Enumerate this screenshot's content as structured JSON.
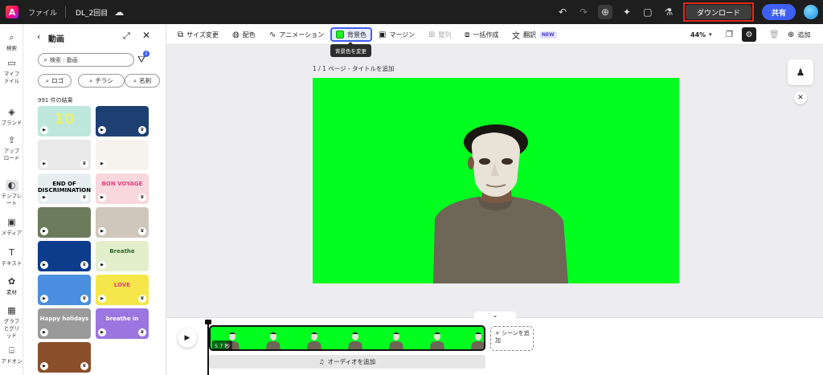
{
  "topbar": {
    "logo": "A",
    "file_menu": "ファイル",
    "doc_title": "DL_2回目",
    "download_label": "ダウンロード",
    "share_label": "共有",
    "icons": [
      "undo-icon",
      "redo-icon",
      "add-person-icon",
      "lightbulb-icon",
      "comment-icon",
      "flask-icon"
    ]
  },
  "rail": {
    "items": [
      {
        "label": "検索",
        "icon": "⌕"
      },
      {
        "label": "マイファイル",
        "icon": "▭"
      },
      {
        "label": "ブランド",
        "icon": "◈"
      },
      {
        "label": "アップロード",
        "icon": "⇪"
      },
      {
        "label": "テンプレート",
        "icon": "◐"
      },
      {
        "label": "メディア",
        "icon": "▣"
      },
      {
        "label": "テキスト",
        "icon": "T"
      },
      {
        "label": "素材",
        "icon": "✿"
      },
      {
        "label": "グラフとグリッド",
        "icon": "▦"
      },
      {
        "label": "アドオン",
        "icon": "⌸"
      }
    ]
  },
  "panel": {
    "title": "動画",
    "search_placeholder": "検索 : 動画",
    "filter_count": "2",
    "chips": [
      "ロゴ",
      "チラシ",
      "名刺"
    ],
    "result_count": "991 件の結果",
    "thumbs": [
      {
        "text": "10",
        "bg": "#bfe8dc",
        "fg": "#e5f073"
      },
      {
        "text": "",
        "bg": "#1e3f72",
        "fg": "#fff"
      },
      {
        "text": "",
        "bg": "#e9e9e9",
        "fg": "#000"
      },
      {
        "text": "",
        "bg": "#f7f4ee",
        "fg": "#000"
      },
      {
        "text": "END OF DISCRIMINATION",
        "bg": "#e6eef0",
        "fg": "#000"
      },
      {
        "text": "BON VOYAGE",
        "bg": "#f8d7dd",
        "fg": "#e0447b"
      },
      {
        "text": "",
        "bg": "#6d7b5d",
        "fg": "#fff"
      },
      {
        "text": "",
        "bg": "#cfc7bb",
        "fg": "#000"
      },
      {
        "text": "",
        "bg": "#0e3c8c",
        "fg": "#fff"
      },
      {
        "text": "Breathe",
        "bg": "#e3efcc",
        "fg": "#2b6a2b"
      },
      {
        "text": "",
        "bg": "#4a8fe0",
        "fg": "#fff"
      },
      {
        "text": "LOVE",
        "bg": "#f5e64a",
        "fg": "#e23a7a"
      },
      {
        "text": "Happy holidays",
        "bg": "#9a9a9a",
        "fg": "#fff"
      },
      {
        "text": "breathe in",
        "bg": "#9b76e0",
        "fg": "#fff"
      },
      {
        "text": "",
        "bg": "#8b4f2c",
        "fg": "#fff"
      }
    ]
  },
  "toolbar": {
    "resize": "サイズ変更",
    "color_scheme": "配色",
    "animation": "アニメーション",
    "background_color": "背景色",
    "margin": "マージン",
    "arrange": "整列",
    "bulk_create": "一括作成",
    "translate": "翻訳",
    "new_badge": "NEW",
    "zoom": "44%",
    "add": "追加",
    "tooltip": "背景色を変更"
  },
  "canvas": {
    "page_label": "1 / 1 ページ - タイトルを追加",
    "bg_color": "#00ff1f"
  },
  "timeline": {
    "duration": "5.7 秒",
    "add_scene": "+ シーンを追加",
    "add_audio": "オーディオを追加",
    "frame_count": 7
  },
  "colors": {
    "accent": "#3e5ff2",
    "highlight_red": "#e0281a",
    "canvas_green": "#00ff1f"
  }
}
